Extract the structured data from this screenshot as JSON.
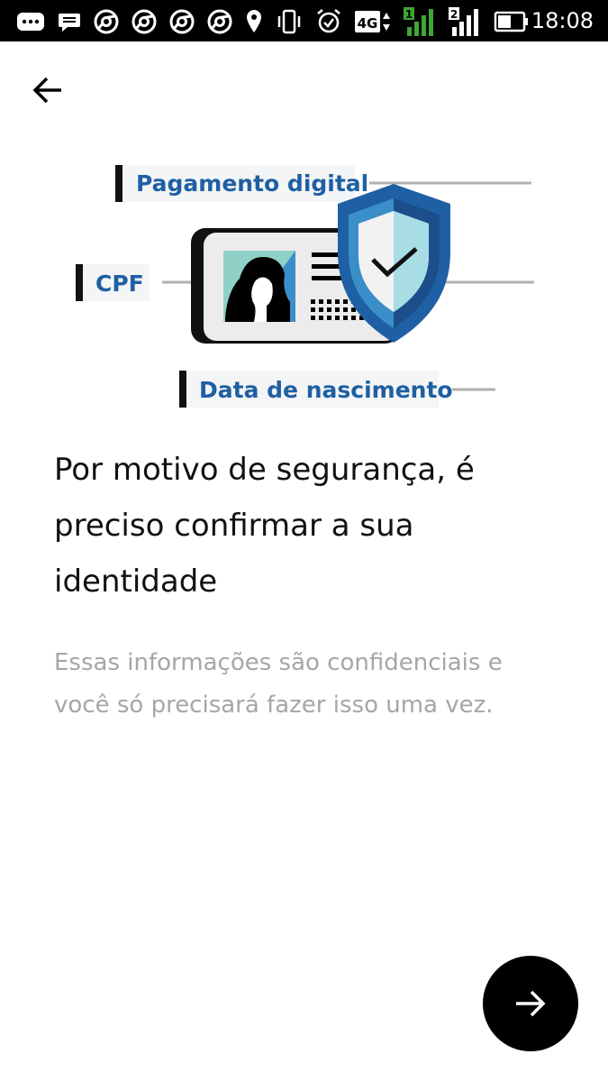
{
  "status_bar": {
    "time": "18:08",
    "network_label": "4G",
    "sim1_label": "1",
    "sim2_label": "2",
    "icons": [
      "messages-icon",
      "chat-icon",
      "chrome-icon",
      "chrome-icon",
      "chrome-icon",
      "chrome-icon",
      "location-icon",
      "vibrate-icon",
      "alarm-icon",
      "network-4g-icon",
      "signal-sim1-icon",
      "signal-sim2-icon",
      "battery-icon"
    ]
  },
  "illustration": {
    "label_digital_payment": "Pagamento digital",
    "label_cpf": "CPF",
    "label_birth_date": "Data de nascimento",
    "accent_color": "#1f5fa3",
    "shield_icon": "shield-check-icon"
  },
  "content": {
    "headline": "Por motivo de segurança, é preciso confirmar a sua identidade",
    "subtext": "Essas informações são confidenciais e você só precisará fazer isso uma vez."
  },
  "actions": {
    "back_icon": "arrow-left-icon",
    "next_icon": "arrow-right-icon"
  }
}
